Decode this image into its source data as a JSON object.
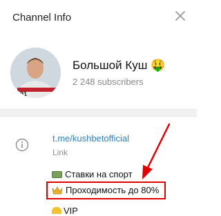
{
  "header": {
    "title": "Channel Info",
    "close_icon": "close-icon"
  },
  "channel": {
    "name": "Большой Куш",
    "name_emoji": "🤑",
    "subscribers": "2 248 subscribers",
    "avatar_shirt_text": "91"
  },
  "info": {
    "icon": "info-icon",
    "link": "t.me/kushbetofficial",
    "link_caption": "Link"
  },
  "description": {
    "line1": "Ставки на спорт",
    "line1_icon": "money-icon",
    "line2": "Проходимость до 80%",
    "line2_icon": "crown-icon",
    "line3_partial": "VIP"
  },
  "annotation": {
    "highlight_color": "#e00000"
  }
}
